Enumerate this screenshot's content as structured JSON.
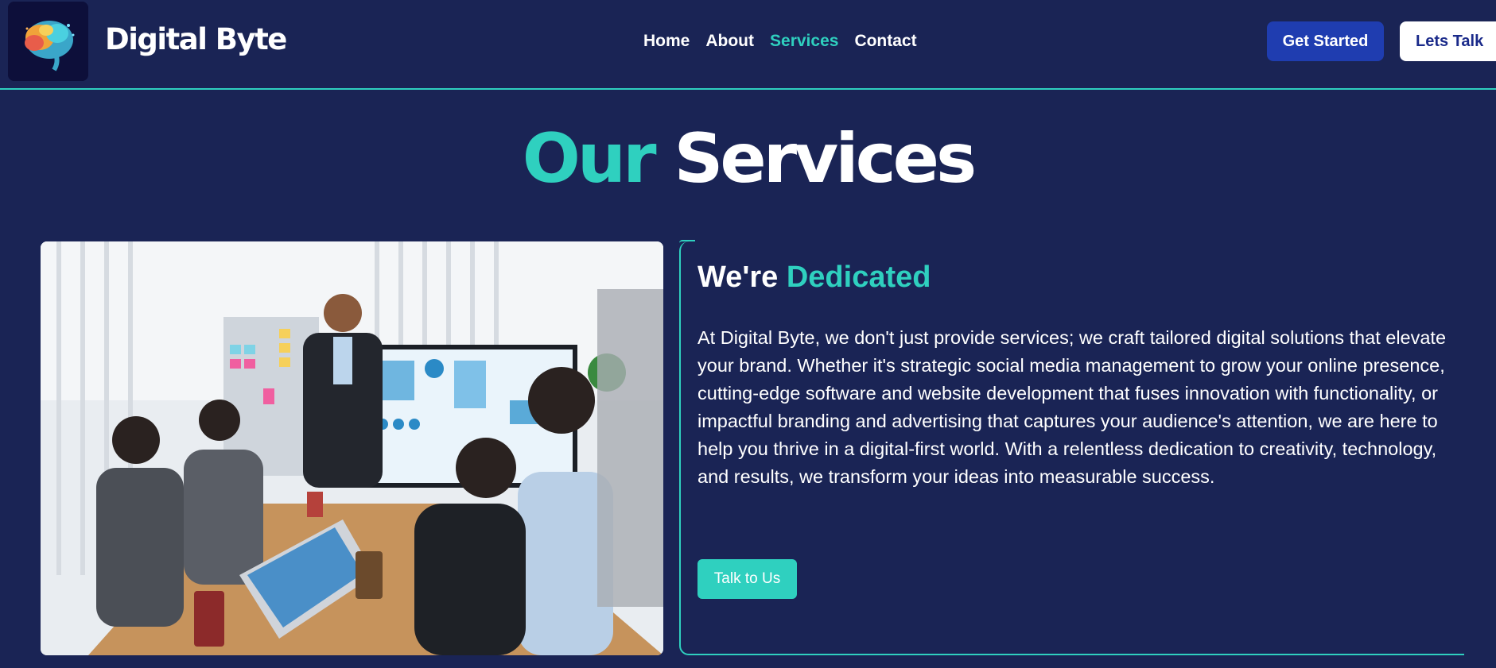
{
  "header": {
    "brand": "Digital Byte",
    "logo_icon": "brain-icon",
    "nav": [
      {
        "label": "Home",
        "active": false
      },
      {
        "label": "About",
        "active": false
      },
      {
        "label": "Services",
        "active": true
      },
      {
        "label": "Contact",
        "active": false
      }
    ],
    "get_started_label": "Get Started",
    "lets_talk_label": "Lets Talk"
  },
  "services": {
    "title_part1": "Our",
    "title_part2": "Services",
    "card": {
      "title_part1": "We're",
      "title_part2": "Dedicated",
      "body": "At Digital Byte, we don't just provide services; we craft tailored digital solutions that elevate your brand. Whether it's strategic social media management to grow your online presence, cutting-edge software and website development that fuses innovation with functionality, or impactful branding and advertising that captures your audience's attention, we are here to help you thrive in a digital-first world. With a relentless dedication to creativity, technology, and results, we transform your ideas into measurable success.",
      "button_label": "Talk to Us"
    }
  },
  "colors": {
    "background": "#1a2455",
    "accent": "#2fd0bf",
    "primary_button": "#1f3db0"
  }
}
